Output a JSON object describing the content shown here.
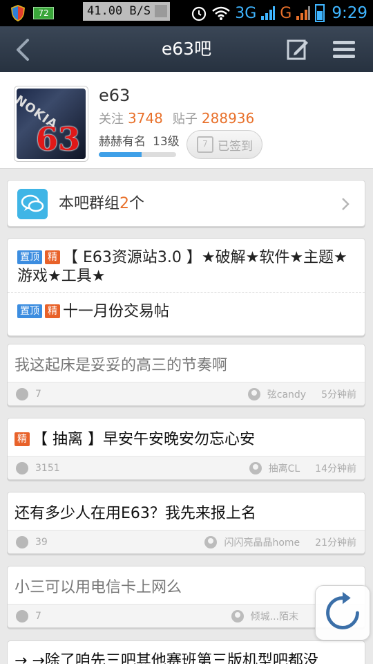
{
  "status_bar": {
    "battery_small": "72",
    "net_speed": "41.00 B/S",
    "network_3g": "3G",
    "network_g": "G",
    "time": "9:29"
  },
  "nav": {
    "title": "e63吧"
  },
  "forum": {
    "name": "e63",
    "follow_label": "关注",
    "follow_count": "3748",
    "posts_label": "贴子",
    "posts_count": "288936",
    "rank_title": "赫赫有名",
    "level": "13级",
    "level_progress": 0.55,
    "signed_label": "已签到",
    "calendar_day": "7",
    "avatar_text": "63",
    "avatar_brand": "NOKIA"
  },
  "group_entry": {
    "label": "本吧群组",
    "count": "2",
    "suffix": "个"
  },
  "pinned": [
    {
      "tags": [
        "置顶",
        "精"
      ],
      "title": "【 E63资源站3.0 】★破解★软件★主题★游戏★工具★"
    },
    {
      "tags": [
        "置顶",
        "精"
      ],
      "title": "十一月份交易帖"
    }
  ],
  "threads": [
    {
      "title": "我这起床是妥妥的高三的节奏啊",
      "replies": "7",
      "author": "弦candy",
      "time": "5分钟前",
      "read": true,
      "tag": ""
    },
    {
      "title": "【 抽离 】早安午安晚安勿忘心安",
      "replies": "3151",
      "author": "抽离CL",
      "time": "14分钟前",
      "read": false,
      "tag": "精"
    },
    {
      "title": "还有多少人在用E63？我先来报上名",
      "replies": "39",
      "author": "闪闪亮晶晶home",
      "time": "21分钟前",
      "read": false,
      "tag": ""
    },
    {
      "title": "小三可以用电信卡上网么",
      "replies": "7",
      "author": "倾城...陌末",
      "time": "",
      "read": true,
      "tag": ""
    },
    {
      "title": "→ →除了咱先三吧其他赛班第三版机型吧都没",
      "replies": "",
      "author": "",
      "time": "",
      "read": false,
      "tag": ""
    }
  ],
  "colors": {
    "accent": "#e8702a",
    "nav_bg": "#2e3a4a",
    "tag_top": "#3c8de0",
    "tag_essence": "#e8622a",
    "status_blue": "#3fb5ff"
  }
}
